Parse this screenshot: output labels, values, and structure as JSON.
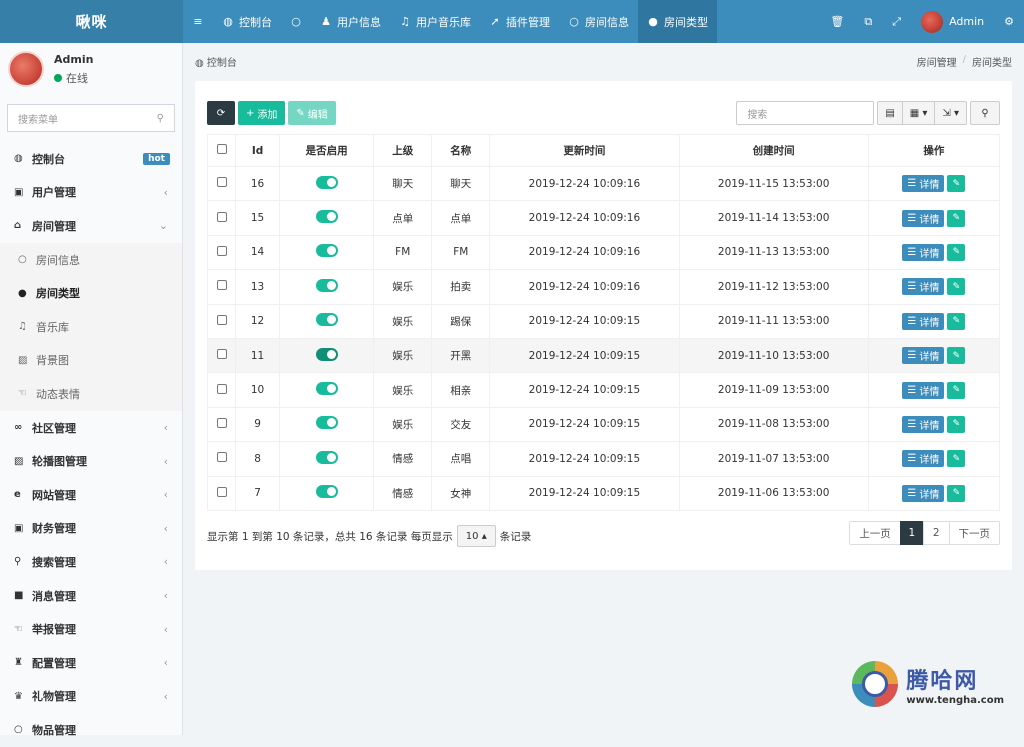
{
  "app": {
    "title": "啾咪"
  },
  "topnav": [
    {
      "icon": "≡",
      "icon_name": "menu-icon",
      "label": ""
    },
    {
      "icon": "◍",
      "icon_name": "dashboard-icon",
      "label": "控制台"
    },
    {
      "icon": "○",
      "icon_name": "circle-icon",
      "label": ""
    },
    {
      "icon": "♟",
      "icon_name": "user-icon",
      "label": "用户信息"
    },
    {
      "icon": "♫",
      "icon_name": "music-icon",
      "label": "用户音乐库"
    },
    {
      "icon": "➚",
      "icon_name": "rocket-icon",
      "label": "插件管理"
    },
    {
      "icon": "○",
      "icon_name": "circle-icon",
      "label": "房间信息"
    },
    {
      "icon": "●",
      "icon_name": "dot-icon",
      "label": "房间类型"
    }
  ],
  "topright": {
    "admin": "Admin"
  },
  "user": {
    "name": "Admin",
    "status": "在线"
  },
  "search": {
    "placeholder": "搜索菜单"
  },
  "sidebar": [
    {
      "icon": "◍",
      "label": "控制台",
      "badge": "hot"
    },
    {
      "icon": "▣",
      "label": "用户管理",
      "arrow": "‹"
    },
    {
      "icon": "⌂",
      "label": "房间管理",
      "arrow": "⌄"
    },
    {
      "icon": "○",
      "label": "房间信息"
    },
    {
      "icon": "●",
      "label": "房间类型"
    },
    {
      "icon": "♫",
      "label": "音乐库"
    },
    {
      "icon": "▨",
      "label": "背景图"
    },
    {
      "icon": "☜",
      "label": "动态表情"
    },
    {
      "icon": "∞",
      "label": "社区管理",
      "arrow": "‹"
    },
    {
      "icon": "▨",
      "label": "轮播图管理",
      "arrow": "‹"
    },
    {
      "icon": "e",
      "label": "网站管理",
      "arrow": "‹"
    },
    {
      "icon": "▣",
      "label": "财务管理",
      "arrow": "‹"
    },
    {
      "icon": "⚲",
      "label": "搜索管理",
      "arrow": "‹"
    },
    {
      "icon": "■",
      "label": "消息管理",
      "arrow": "‹"
    },
    {
      "icon": "☜",
      "label": "举报管理",
      "arrow": "‹"
    },
    {
      "icon": "♜",
      "label": "配置管理",
      "arrow": "‹"
    },
    {
      "icon": "♛",
      "label": "礼物管理",
      "arrow": "‹"
    },
    {
      "icon": "○",
      "label": "物品管理"
    }
  ],
  "breadcrumb": {
    "left": "控制台",
    "right1": "房间管理",
    "sep": "/",
    "right2": "房间类型"
  },
  "toolbar": {
    "refresh": "⟳",
    "add": "添加",
    "edit": "编辑",
    "search_placeholder": "搜索"
  },
  "table": {
    "headers": [
      "Id",
      "是否启用",
      "上级",
      "名称",
      "更新时间",
      "创建时间",
      "操作"
    ],
    "detail_label": "详情",
    "rows": [
      {
        "id": "16",
        "parent": "聊天",
        "name": "聊天",
        "updated": "2019-12-24 10:09:16",
        "created": "2019-11-15 13:53:00"
      },
      {
        "id": "15",
        "parent": "点单",
        "name": "点单",
        "updated": "2019-12-24 10:09:16",
        "created": "2019-11-14 13:53:00"
      },
      {
        "id": "14",
        "parent": "FM",
        "name": "FM",
        "updated": "2019-12-24 10:09:16",
        "created": "2019-11-13 13:53:00"
      },
      {
        "id": "13",
        "parent": "娱乐",
        "name": "拍卖",
        "updated": "2019-12-24 10:09:16",
        "created": "2019-11-12 13:53:00"
      },
      {
        "id": "12",
        "parent": "娱乐",
        "name": "踢保",
        "updated": "2019-12-24 10:09:15",
        "created": "2019-11-11 13:53:00"
      },
      {
        "id": "11",
        "parent": "娱乐",
        "name": "开黑",
        "updated": "2019-12-24 10:09:15",
        "created": "2019-11-10 13:53:00"
      },
      {
        "id": "10",
        "parent": "娱乐",
        "name": "相亲",
        "updated": "2019-12-24 10:09:15",
        "created": "2019-11-09 13:53:00"
      },
      {
        "id": "9",
        "parent": "娱乐",
        "name": "交友",
        "updated": "2019-12-24 10:09:15",
        "created": "2019-11-08 13:53:00"
      },
      {
        "id": "8",
        "parent": "情感",
        "name": "点唱",
        "updated": "2019-12-24 10:09:15",
        "created": "2019-11-07 13:53:00"
      },
      {
        "id": "7",
        "parent": "情感",
        "name": "女神",
        "updated": "2019-12-24 10:09:15",
        "created": "2019-11-06 13:53:00"
      }
    ]
  },
  "pagination": {
    "info_before": "显示第 1 到第 10 条记录，总共 16 条记录 每页显示",
    "page_size": "10",
    "info_after": "条记录",
    "prev": "上一页",
    "pages": [
      "1",
      "2"
    ],
    "next": "下一页"
  },
  "watermark": {
    "title": "腾哈网",
    "url": "www.tengha.com"
  },
  "colors": {
    "primary": "#3c8dbc",
    "success": "#18bc9c",
    "dark": "#2c3b41"
  }
}
